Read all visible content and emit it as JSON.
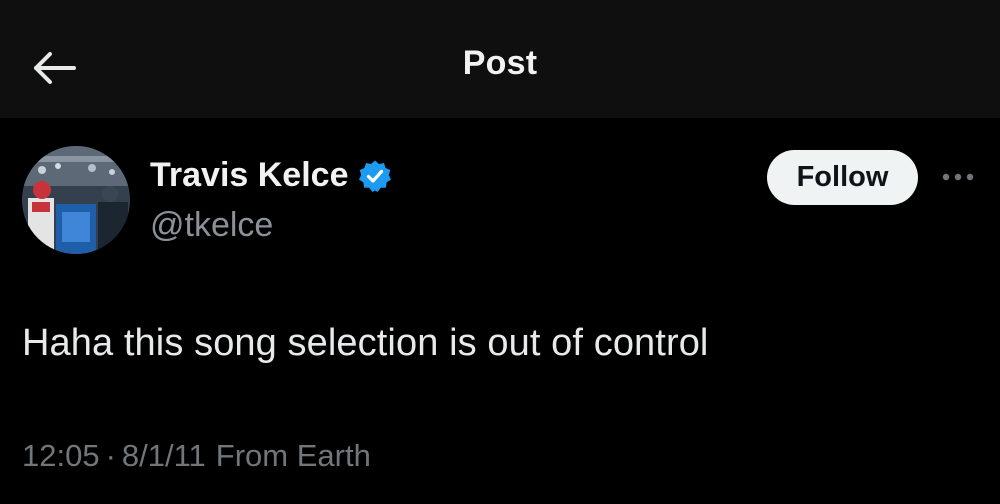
{
  "header": {
    "title": "Post"
  },
  "post": {
    "author": {
      "name": "Travis Kelce",
      "handle": "@tkelce",
      "verified": true
    },
    "follow_label": "Follow",
    "text": "Haha this song selection is out of control",
    "time": "12:05",
    "separator": "·",
    "date": "8/1/11",
    "location": "From Earth"
  },
  "colors": {
    "background": "#000000",
    "header_background": "#0f0f0f",
    "verified_badge": "#1d9bf0",
    "secondary_text": "#71767b",
    "follow_button": "#eff3f4"
  },
  "icons": {
    "back": "arrow-left-icon",
    "verified": "verified-badge-icon",
    "more": "more-horizontal-icon"
  }
}
